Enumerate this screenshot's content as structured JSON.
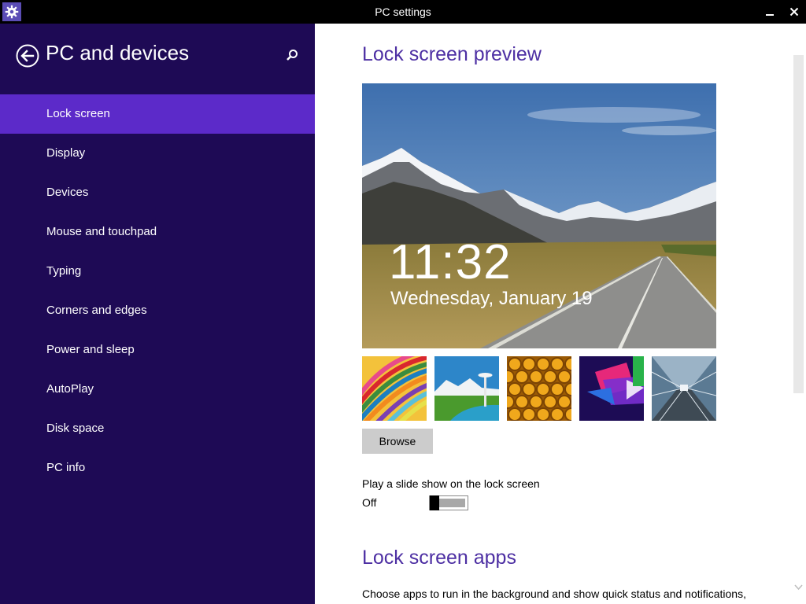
{
  "window": {
    "title": "PC settings",
    "app_icon": "gear-icon",
    "minimize_icon": "minimize-icon",
    "close_icon": "close-icon"
  },
  "sidebar": {
    "title": "PC and devices",
    "back_icon": "back-arrow-icon",
    "search_icon": "search-icon",
    "items": [
      {
        "label": "Lock screen",
        "active": true
      },
      {
        "label": "Display"
      },
      {
        "label": "Devices"
      },
      {
        "label": "Mouse and touchpad"
      },
      {
        "label": "Typing"
      },
      {
        "label": "Corners and edges"
      },
      {
        "label": "Power and sleep"
      },
      {
        "label": "AutoPlay"
      },
      {
        "label": "Disk space"
      },
      {
        "label": "PC info"
      }
    ]
  },
  "main": {
    "preview_heading": "Lock screen preview",
    "preview": {
      "time": "11:32",
      "date": "Wednesday, January 19"
    },
    "browse_label": "Browse",
    "slideshow": {
      "label": "Play a slide show on the lock screen",
      "state": "Off"
    },
    "apps_heading": "Lock screen apps",
    "apps_description": "Choose apps to run in the background and show quick status and notifications,"
  },
  "colors": {
    "sidebar_bg": "#1e0a55",
    "active_item_bg": "#5c2ac9",
    "heading": "#4d2fa3"
  }
}
